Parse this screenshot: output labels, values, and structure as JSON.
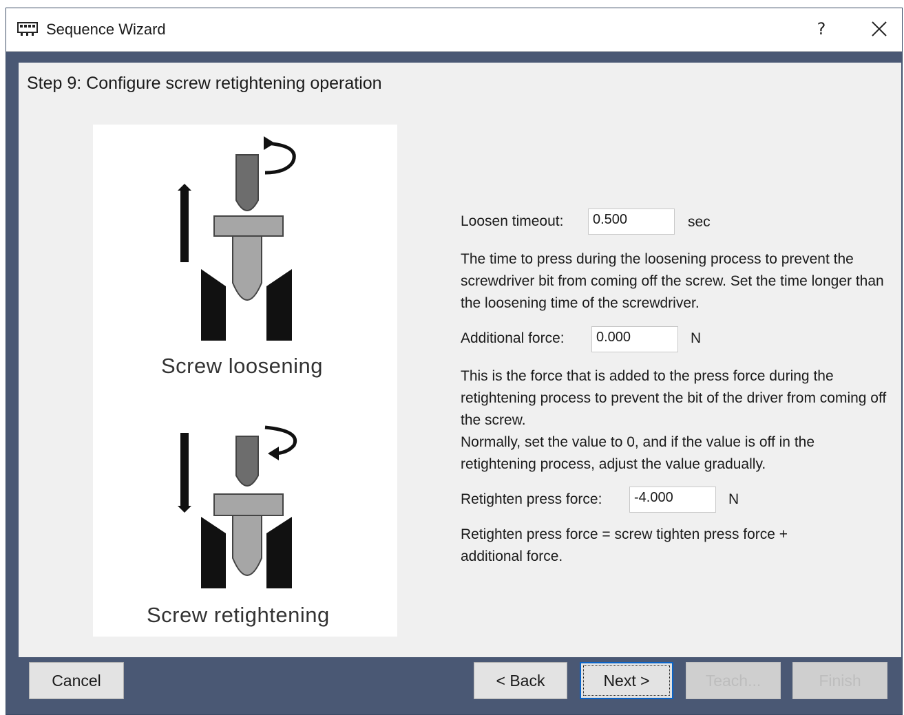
{
  "window": {
    "title": "Sequence Wizard",
    "help_label": "?"
  },
  "content": {
    "step_title": "Step 9: Configure screw retightening operation",
    "illustration": {
      "caption_loosening": "Screw loosening",
      "caption_retightening": "Screw retightening"
    },
    "form": {
      "loosen_timeout_label": "Loosen timeout:",
      "loosen_timeout_value": "0.500",
      "loosen_timeout_unit": "sec",
      "loosen_timeout_desc": "The time to press during the loosening process to prevent the screwdriver bit from coming off the screw. Set the time longer than the loosening time of the screwdriver.",
      "additional_force_label": "Additional force:",
      "additional_force_value": "0.000",
      "additional_force_unit": "N",
      "additional_force_desc_1": "This is the force that is added to the press force during the retightening process to prevent the bit of the driver from coming off the screw.",
      "additional_force_desc_2": "Normally, set the value to 0, and if the value is off in the retightening process, adjust the value gradually.",
      "retighten_label": "Retighten press force:",
      "retighten_value": "-4.000",
      "retighten_unit": "N",
      "retighten_desc": "Retighten press force = screw tighten press force + additional force."
    }
  },
  "buttons": {
    "cancel": "Cancel",
    "back": "< Back",
    "next": "Next >",
    "teach": "Teach...",
    "finish": "Finish"
  },
  "colors": {
    "frame": "#4a5874",
    "panel": "#f0f0f0",
    "focus": "#0a64c8"
  }
}
